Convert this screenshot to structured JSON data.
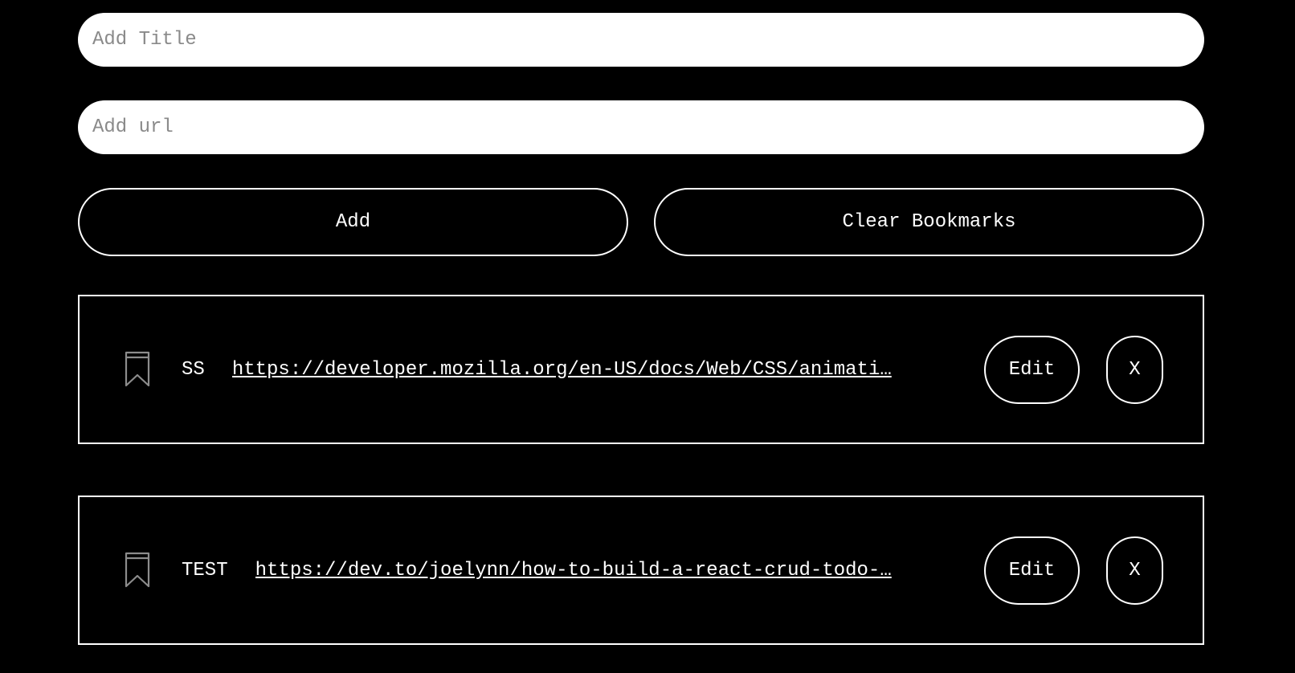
{
  "form": {
    "title_placeholder": "Add Title",
    "title_value": "",
    "url_placeholder": "Add url",
    "url_value": "",
    "add_label": "Add",
    "clear_label": "Clear Bookmarks"
  },
  "bookmarks": [
    {
      "icon": "bookmark-icon",
      "title": "SS",
      "url": "https://developer.mozilla.org/en-US/docs/Web/CSS/animati…",
      "edit_label": "Edit",
      "delete_label": "X"
    },
    {
      "icon": "bookmark-icon",
      "title": "TEST",
      "url": "https://dev.to/joelynn/how-to-build-a-react-crud-todo-…",
      "edit_label": "Edit",
      "delete_label": "X"
    }
  ],
  "colors": {
    "background": "#000000",
    "foreground": "#ffffff",
    "placeholder": "#8a8a8a",
    "icon": "#8c8c8c"
  }
}
